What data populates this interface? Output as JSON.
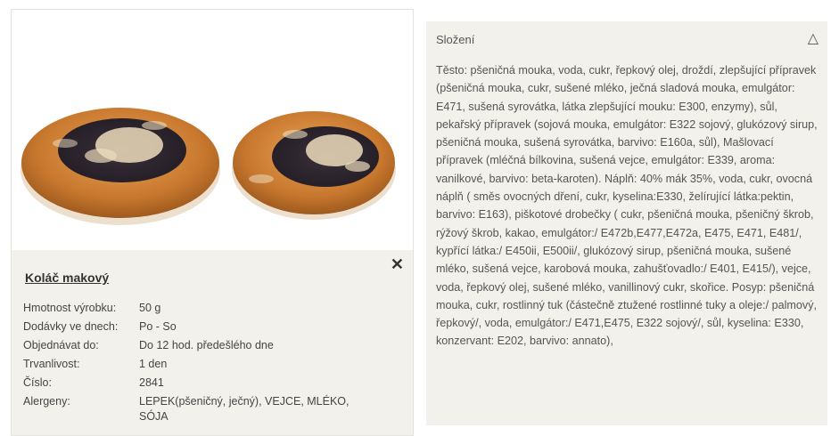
{
  "product": {
    "title": "Koláč makový",
    "close_symbol": "✕",
    "properties": [
      {
        "key": "Hmotnost výrobku:",
        "value": "50 g"
      },
      {
        "key": "Dodávky ve dnech:",
        "value": "Po - So"
      },
      {
        "key": "Objednávat do:",
        "value": "Do 12 hod. předešlého dne"
      },
      {
        "key": "Trvanlivost:",
        "value": "1 den"
      },
      {
        "key": "Číslo:",
        "value": "2841"
      },
      {
        "key": "Alergeny:",
        "value": "LEPEK(pšeničný, ječný), VEJCE, MLÉKO, SÓJA"
      }
    ]
  },
  "composition": {
    "heading": "Složení",
    "toggle_symbol": "△",
    "text": "Těsto: pšeničná mouka, voda, cukr, řepkový olej, droždí, zlepšující přípravek (pšeničná mouka, cukr, sušené mléko, ječná sladová mouka, emulgátor: E471, sušená syrovátka, látka zlepšující mouku: E300, enzymy), sůl, pekařský přípravek (sojová mouka, emulgátor: E322 sojový, glukózový sirup, pšeničná mouka, sušená syrovátka, barvivo: E160a, sůl), Mašlovací přípravek (mléčná bílkovina, sušená vejce, emulgátor: E339, aroma: vanilkové, barvivo: beta-karoten). Náplň: 40% mák 35%, voda, cukr, ovocná náplň ( směs ovocných dření, cukr, kyselina:E330, želírující látka:pektin, barvivo: E163), piškotové drobečky ( cukr, pšeničná mouka, pšeničný škrob, rýžový škrob, kakao, emulgátor:/ E472b,E477,E472a, E475, E471, E481/, kypřící látka:/ E450ii, E500ii/, glukózový sirup, pšeničná mouka, sušené mléko, sušená vejce, karobová mouka, zahušťovadlo:/ E401, E415/), vejce, voda, řepkový olej, sušené mléko, vanillinový cukr, skořice. Posyp: pšeničná mouka, cukr, rostlinný tuk (částečně ztužené rostlinné tuky a oleje:/ palmový, řepkový/, voda, emulgátor:/ E471,E475, E322 sojový/, sůl, kyselina: E330, konzervant: E202, barvivo: annato),"
  },
  "colors": {
    "panel_bg": "#f3f1ec",
    "crust": "#c8782e",
    "poppy": "#2e2630",
    "crumble": "#ecdcbc"
  }
}
